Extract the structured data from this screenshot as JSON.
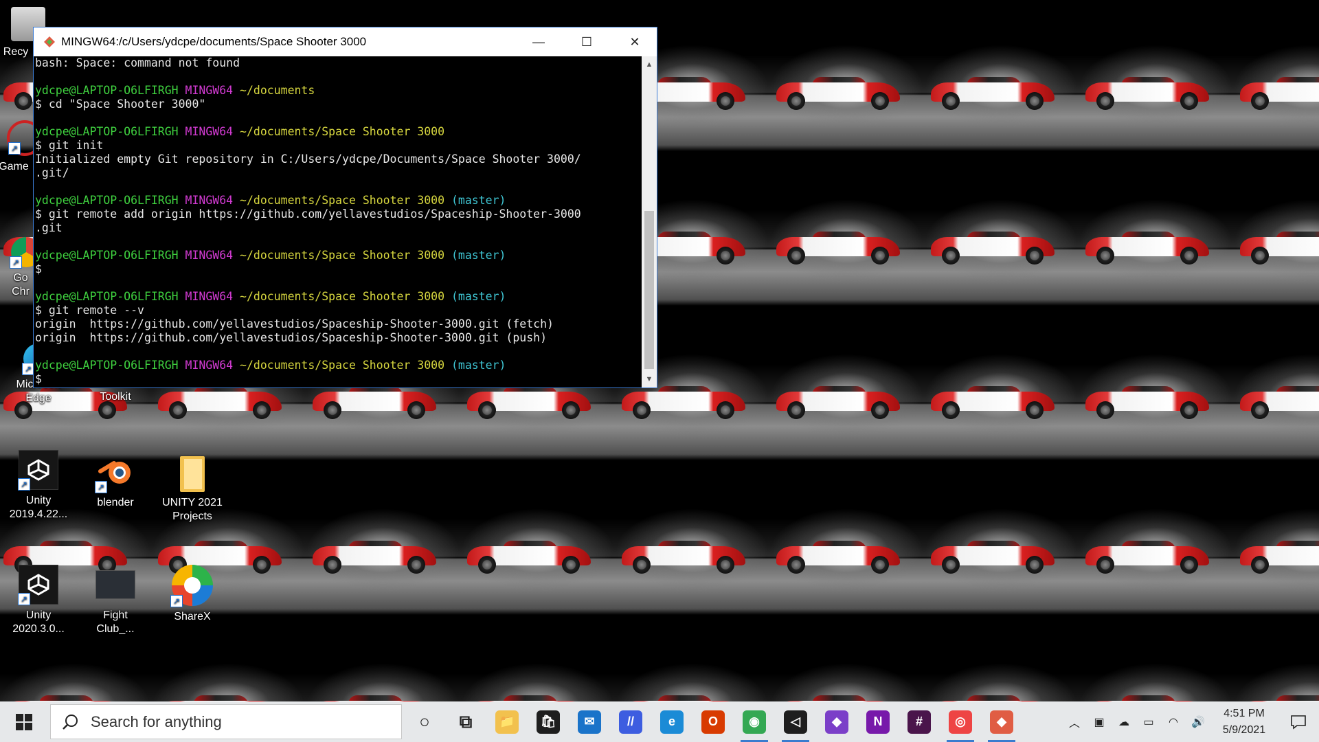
{
  "window": {
    "title": "MINGW64:/c/Users/ydcpe/documents/Space Shooter 3000",
    "minimize_label": "—",
    "maximize_label": "☐",
    "close_label": "✕"
  },
  "terminal": {
    "lines": [
      {
        "segments": [
          {
            "text": "bash: Space: command not found",
            "color": "white"
          }
        ]
      },
      {
        "segments": []
      },
      {
        "segments": [
          {
            "text": "ydcpe@LAPTOP-O6LFIRGH ",
            "color": "green"
          },
          {
            "text": "MINGW64 ",
            "color": "magenta"
          },
          {
            "text": "~/documents",
            "color": "yellow"
          }
        ]
      },
      {
        "segments": [
          {
            "text": "$ cd \"Space Shooter 3000\"",
            "color": "white"
          }
        ]
      },
      {
        "segments": []
      },
      {
        "segments": [
          {
            "text": "ydcpe@LAPTOP-O6LFIRGH ",
            "color": "green"
          },
          {
            "text": "MINGW64 ",
            "color": "magenta"
          },
          {
            "text": "~/documents/Space Shooter 3000",
            "color": "yellow"
          }
        ]
      },
      {
        "segments": [
          {
            "text": "$ git init",
            "color": "white"
          }
        ]
      },
      {
        "segments": [
          {
            "text": "Initialized empty Git repository in C:/Users/ydcpe/Documents/Space Shooter 3000/",
            "color": "white"
          }
        ]
      },
      {
        "segments": [
          {
            "text": ".git/",
            "color": "white"
          }
        ]
      },
      {
        "segments": []
      },
      {
        "segments": [
          {
            "text": "ydcpe@LAPTOP-O6LFIRGH ",
            "color": "green"
          },
          {
            "text": "MINGW64 ",
            "color": "magenta"
          },
          {
            "text": "~/documents/Space Shooter 3000 ",
            "color": "yellow"
          },
          {
            "text": "(master)",
            "color": "cyan"
          }
        ]
      },
      {
        "segments": [
          {
            "text": "$ git remote add origin https://github.com/yellavestudios/Spaceship-Shooter-3000",
            "color": "white"
          }
        ]
      },
      {
        "segments": [
          {
            "text": ".git",
            "color": "white"
          }
        ]
      },
      {
        "segments": []
      },
      {
        "segments": [
          {
            "text": "ydcpe@LAPTOP-O6LFIRGH ",
            "color": "green"
          },
          {
            "text": "MINGW64 ",
            "color": "magenta"
          },
          {
            "text": "~/documents/Space Shooter 3000 ",
            "color": "yellow"
          },
          {
            "text": "(master)",
            "color": "cyan"
          }
        ]
      },
      {
        "segments": [
          {
            "text": "$",
            "color": "white"
          }
        ]
      },
      {
        "segments": []
      },
      {
        "segments": [
          {
            "text": "ydcpe@LAPTOP-O6LFIRGH ",
            "color": "green"
          },
          {
            "text": "MINGW64 ",
            "color": "magenta"
          },
          {
            "text": "~/documents/Space Shooter 3000 ",
            "color": "yellow"
          },
          {
            "text": "(master)",
            "color": "cyan"
          }
        ]
      },
      {
        "segments": [
          {
            "text": "$ git remote --v",
            "color": "white"
          }
        ]
      },
      {
        "segments": [
          {
            "text": "origin  https://github.com/yellavestudios/Spaceship-Shooter-3000.git (fetch)",
            "color": "white"
          }
        ]
      },
      {
        "segments": [
          {
            "text": "origin  https://github.com/yellavestudios/Spaceship-Shooter-3000.git (push)",
            "color": "white"
          }
        ]
      },
      {
        "segments": []
      },
      {
        "segments": [
          {
            "text": "ydcpe@LAPTOP-O6LFIRGH ",
            "color": "green"
          },
          {
            "text": "MINGW64 ",
            "color": "magenta"
          },
          {
            "text": "~/documents/Space Shooter 3000 ",
            "color": "yellow"
          },
          {
            "text": "(master)",
            "color": "cyan"
          }
        ]
      },
      {
        "segments": [
          {
            "text": "$",
            "color": "white"
          }
        ]
      }
    ]
  },
  "desktop_icons": {
    "recycle": "Recy",
    "game": "Game",
    "chrome_1": "Go",
    "chrome_2": "Chr",
    "edge_1": "Microsoft",
    "edge_2": "Edge",
    "toolkit": "Toolkit",
    "unity1_1": "Unity",
    "unity1_2": "2019.4.22...",
    "blender": "blender",
    "unityproj_1": "UNITY 2021",
    "unityproj_2": "Projects",
    "unity2_1": "Unity",
    "unity2_2": "2020.3.0...",
    "fight_1": "Fight",
    "fight_2": "Club_...",
    "sharex": "ShareX"
  },
  "taskbar": {
    "search_placeholder": "Search for anything",
    "apps": [
      {
        "name": "cortana",
        "glyph": "○",
        "color": "#e6e8ea"
      },
      {
        "name": "task-view",
        "glyph": "⧉",
        "color": "#e6e8ea"
      },
      {
        "name": "file-explorer",
        "glyph": "📁",
        "color": "#f2c14e"
      },
      {
        "name": "microsoft-store",
        "glyph": "🛍",
        "color": "#1e1e1e"
      },
      {
        "name": "mail",
        "glyph": "✉",
        "color": "#1a73c9"
      },
      {
        "name": "visual-studio-code-alt",
        "glyph": "//",
        "color": "#3d5de0"
      },
      {
        "name": "edge",
        "glyph": "e",
        "color": "#1b8bd6"
      },
      {
        "name": "office",
        "glyph": "O",
        "color": "#d83b01"
      },
      {
        "name": "chrome",
        "glyph": "◉",
        "color": "#34a853"
      },
      {
        "name": "unity",
        "glyph": "◁",
        "color": "#1e1e1e"
      },
      {
        "name": "visual-studio",
        "glyph": "◆",
        "color": "#7b3fc8"
      },
      {
        "name": "onenote",
        "glyph": "N",
        "color": "#7719aa"
      },
      {
        "name": "slack",
        "glyph": "#",
        "color": "#4a154b"
      },
      {
        "name": "sharex",
        "glyph": "◎",
        "color": "#e44"
      },
      {
        "name": "git-bash",
        "glyph": "◆",
        "color": "#e05d44"
      }
    ],
    "time": "4:51 PM",
    "date": "5/9/2021"
  }
}
